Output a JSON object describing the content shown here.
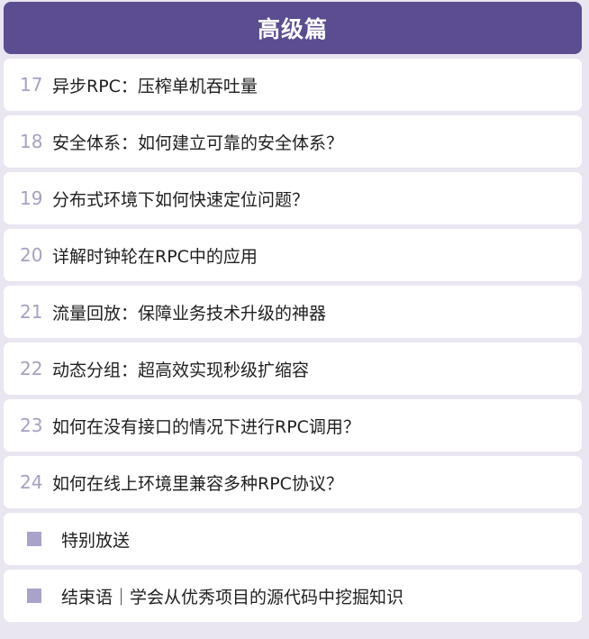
{
  "theme": {
    "header_bg": "#5c4d91",
    "bullet_color": "#a9a3cc"
  },
  "section": {
    "title": "高级篇"
  },
  "items": [
    {
      "number": "17",
      "title": "异步RPC：压榨单机吞吐量"
    },
    {
      "number": "18",
      "title": "安全体系：如何建立可靠的安全体系？"
    },
    {
      "number": "19",
      "title": "分布式环境下如何快速定位问题？"
    },
    {
      "number": "20",
      "title": "详解时钟轮在RPC中的应用"
    },
    {
      "number": "21",
      "title": "流量回放：保障业务技术升级的神器"
    },
    {
      "number": "22",
      "title": "动态分组：超高效实现秒级扩缩容"
    },
    {
      "number": "23",
      "title": "如何在没有接口的情况下进行RPC调用？"
    },
    {
      "number": "24",
      "title": "如何在线上环境里兼容多种RPC协议？"
    }
  ],
  "extras": [
    {
      "icon": "square-bullet-icon",
      "title": "特别放送"
    },
    {
      "icon": "square-bullet-icon",
      "title": "结束语｜学会从优秀项目的源代码中挖掘知识"
    }
  ]
}
